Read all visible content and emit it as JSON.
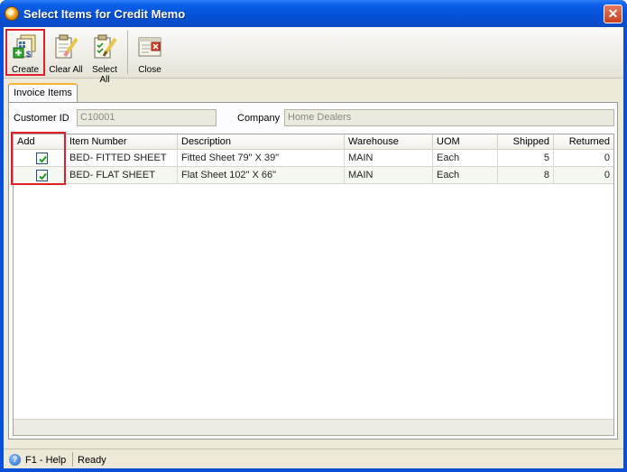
{
  "window": {
    "title": "Select Items for Credit Memo",
    "close_glyph": "✕"
  },
  "toolbar": {
    "create_label": "Create",
    "clear_all_label": "Clear All",
    "select_all_label": "Select All",
    "close_label": "Close"
  },
  "tabs": [
    {
      "label": "Invoice Items",
      "selected": true
    }
  ],
  "form": {
    "customer_id_label": "Customer ID",
    "customer_id_value": "C10001",
    "company_label": "Company",
    "company_value": "Home Dealers"
  },
  "grid": {
    "columns": [
      "Add",
      "Item Number",
      "Description",
      "Warehouse",
      "UOM",
      "Shipped",
      "Returned"
    ],
    "rows": [
      {
        "add": true,
        "item_number": "BED- FITTED SHEET",
        "description": "Fitted Sheet 79\" X 39\"",
        "warehouse": "MAIN",
        "uom": "Each",
        "shipped": "5",
        "returned": "0"
      },
      {
        "add": true,
        "item_number": "BED- FLAT SHEET",
        "description": "Flat Sheet 102\" X 66\"",
        "warehouse": "MAIN",
        "uom": "Each",
        "shipped": "8",
        "returned": "0"
      }
    ]
  },
  "statusbar": {
    "help": "F1 - Help",
    "status": "Ready",
    "help_icon": "?"
  },
  "colors": {
    "title_bar": "#0451d6",
    "highlight": "#e01f2a",
    "checkbox_tick": "#21a121",
    "tab_accent": "#f7b436"
  },
  "icons": [
    "app-icon",
    "create-icon",
    "clear-all-icon",
    "select-all-icon",
    "close-doc-icon",
    "help-icon",
    "checkbox-checked-icon"
  ]
}
